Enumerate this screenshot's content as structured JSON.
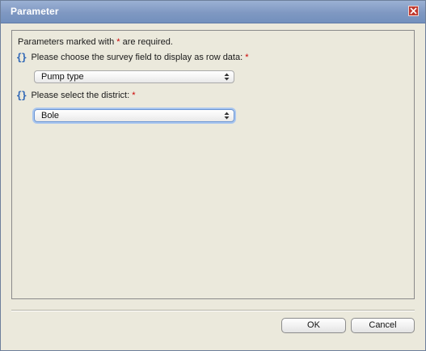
{
  "dialog": {
    "title": "Parameter",
    "close_icon": "close-icon",
    "required_note_prefix": "Parameters marked with ",
    "required_star": "*",
    "required_note_suffix": " are required.",
    "params": [
      {
        "icon": "braces-icon",
        "label": "Please choose the survey field to display as row data:",
        "star": "*",
        "selected": "Pump type"
      },
      {
        "icon": "braces-icon",
        "label": "Please select the district:",
        "star": "*",
        "selected": "Bole"
      }
    ],
    "ok_label": "OK",
    "cancel_label": "Cancel"
  },
  "colors": {
    "titlebar": "#7f98c2",
    "background": "#ebe9dc",
    "required_star": "#cc0000",
    "braces": "#2b64b5",
    "focus_ring": "#a9c6ef"
  }
}
